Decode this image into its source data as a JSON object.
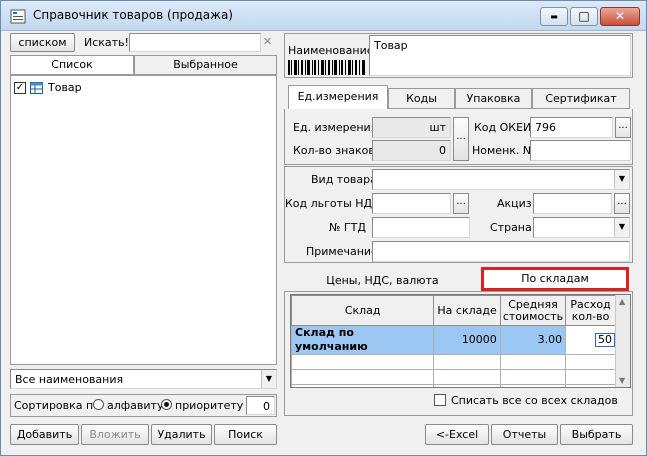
{
  "window": {
    "title": "Справочник товаров (продажа)",
    "controls": {
      "minimize": "▬",
      "maximize": "□",
      "close": "✕"
    }
  },
  "left": {
    "list_mode_button": "списком",
    "search_label": "Искать!",
    "search_value": "",
    "clear_glyph": "✕",
    "tabs": [
      "Список",
      "Выбранное"
    ],
    "tree": [
      {
        "label": "Товар",
        "checked": true
      }
    ],
    "filter_value": "Все наименования",
    "sort_label": "Сортировка по",
    "sort_options": [
      "алфавиту",
      "приоритету"
    ],
    "sort_selected": "приоритету",
    "priority_value": "0"
  },
  "right": {
    "name_label": "Наименование",
    "name_value": "Товар",
    "tabs": [
      "Ед.измерения",
      "Коды",
      "Упаковка",
      "Сертификат"
    ],
    "active_tab": "Ед.измерения",
    "unit": {
      "unit_label": "Ед. измерения",
      "unit_value": "шт",
      "digits_label": "Кол-во знаков",
      "digits_value": "0",
      "okei_label": "Код ОКЕИ",
      "okei_value": "796",
      "nomenk_label": "Номенк. №",
      "nomenk_value": ""
    },
    "attrs": {
      "kind_label": "Вид товара",
      "kind_value": "",
      "vat_benefit_label": "Код льготы НДС",
      "vat_benefit_value": "",
      "excise_label": "Акциз",
      "excise_value": "",
      "gtd_label": "№ ГТД",
      "gtd_value": "",
      "country_label": "Страна",
      "country_value": "",
      "note_label": "Примечание",
      "note_value": ""
    },
    "bottom_tabs": [
      "Цены, НДС, валюта",
      "По складам"
    ],
    "active_bottom_tab": "По складам",
    "grid": {
      "headers": [
        "Склад",
        "На складе",
        "Средняя стоимость",
        "Расход кол-во"
      ],
      "rows": [
        {
          "warehouse": "Склад по умолчанию",
          "stock": "10000",
          "avg_cost": "3.00",
          "qty": "50"
        }
      ],
      "empty_rows": 4
    },
    "write_off_label": "Списать все со всех складов"
  },
  "footer": {
    "add": "Добавить",
    "nest": "Вложить",
    "delete": "Удалить",
    "search": "Поиск",
    "excel": "<-Excel",
    "reports": "Отчеты",
    "select": "Выбрать"
  },
  "colors": {
    "highlight_row": "#9bc7f2",
    "focus_frame": "#e02020",
    "titlebar": "#c8dcf0"
  }
}
